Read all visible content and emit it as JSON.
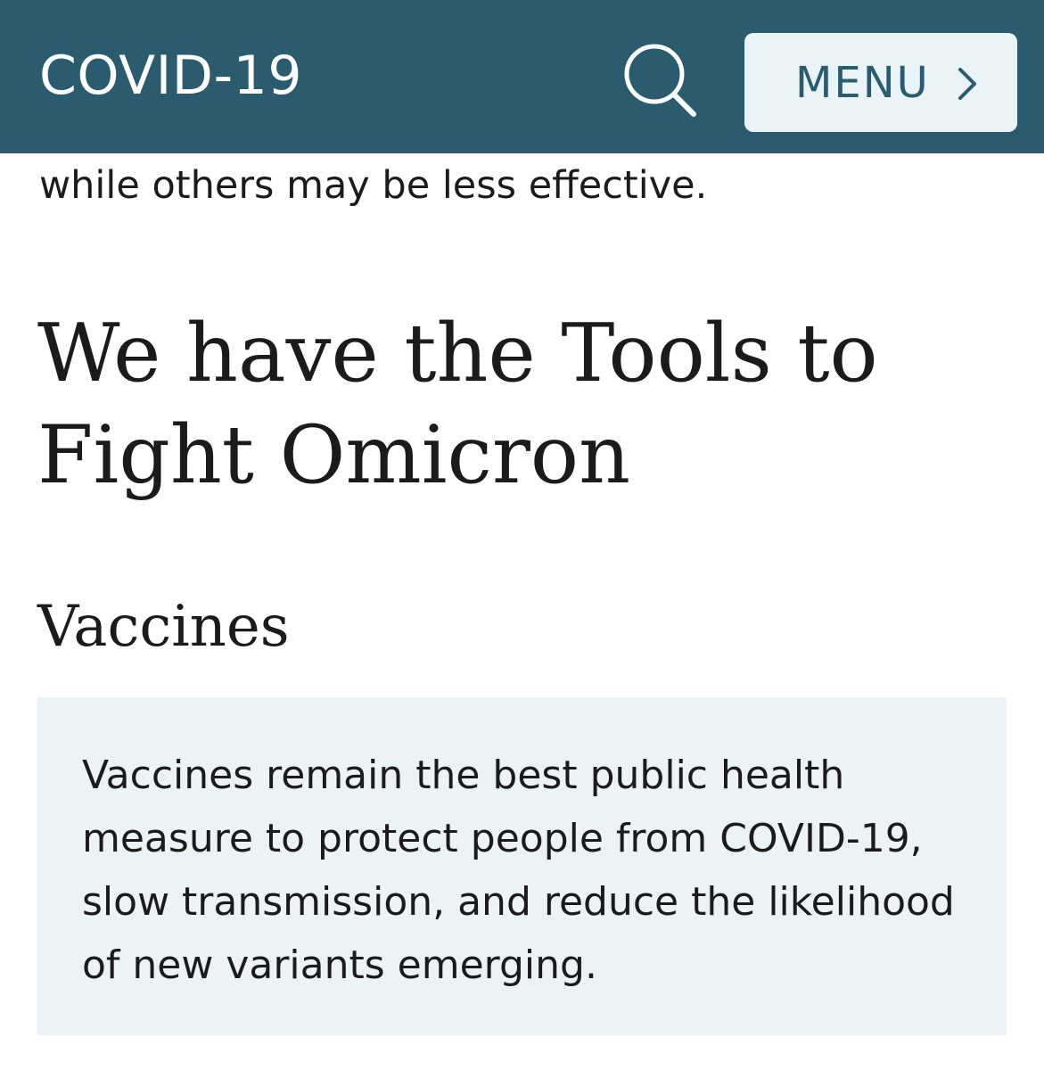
{
  "header": {
    "site_title": "COVID-19",
    "search_icon": "search-icon",
    "menu_label": "MENU",
    "menu_icon": "chevron-right-icon",
    "background_color": "#2a5b6f",
    "menu_background_color": "#eaf3f6"
  },
  "content": {
    "preceding_text": "while others may be less effective.",
    "heading": "We have the Tools to Fight Omicron",
    "subheading": "Vaccines",
    "callout_text": "Vaccines remain the best public health measure to protect people from COVID-19, slow transmission, and reduce the likelihood of new variants emerging.",
    "callout_background_color": "#ebf3f6"
  }
}
